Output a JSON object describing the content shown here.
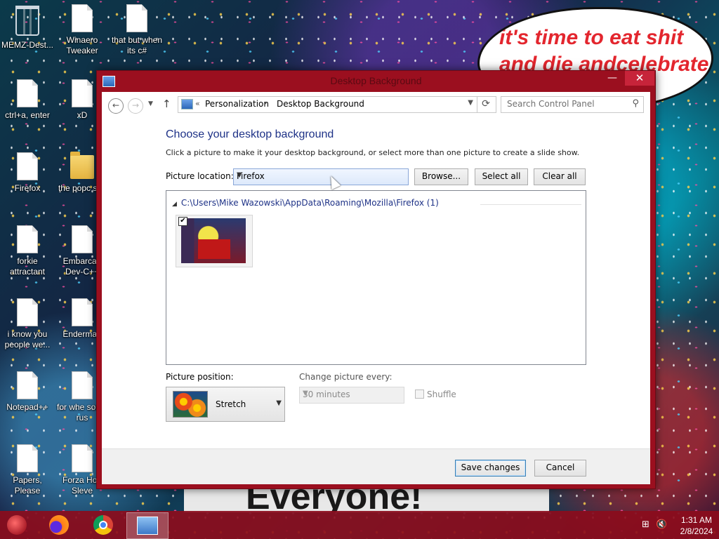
{
  "wallpaper": {
    "bubble_line1": "it's time to eat shit",
    "bubble_line2": "and die andcelebrate",
    "sign_text": "Everyone!"
  },
  "desktop_icons": [
    {
      "label": "MEMZ-Dest...",
      "type": "bin"
    },
    {
      "label": "Winaero Tweaker",
      "type": "doc"
    },
    {
      "label": "that but when its c#",
      "type": "doc"
    },
    {
      "label": "ctrl+a, enter",
      "type": "doc"
    },
    {
      "label": "xD",
      "type": "doc"
    },
    {
      "label": "Firefox",
      "type": "doc"
    },
    {
      "label": "the popc shit",
      "type": "folder"
    },
    {
      "label": "forkie attractant",
      "type": "doc"
    },
    {
      "label": "Embarcad Dev-C++",
      "type": "doc"
    },
    {
      "label": "i know you people we...",
      "type": "doc"
    },
    {
      "label": "Enderman",
      "type": "doc"
    },
    {
      "label": "Notepad++",
      "type": "doc"
    },
    {
      "label": "for whe some rus",
      "type": "doc"
    },
    {
      "label": "Papers, Please",
      "type": "doc"
    },
    {
      "label": "Forza Hori Sleve",
      "type": "doc"
    }
  ],
  "window": {
    "title": "Desktop Background",
    "minimize": "—",
    "maximize": "▢",
    "close": "✕",
    "nav": {
      "back": "←",
      "forward": "→",
      "up": "↑",
      "breadcrumb_prefix": "«",
      "crumb1": "Personalization",
      "separator": "›",
      "crumb2": "Desktop Background",
      "refresh": "⟳",
      "search_placeholder": "Search Control Panel",
      "search_icon": "⚲"
    },
    "heading": "Choose your desktop background",
    "description": "Click a picture to make it your desktop background, or select more than one picture to create a slide show.",
    "picture_location_label": "Picture location:",
    "picture_location_value": "Firefox",
    "browse_button": "Browse...",
    "select_all_button": "Select all",
    "clear_all_button": "Clear all",
    "group_header": "C:\\Users\\Mike Wazowski\\AppData\\Roaming\\Mozilla\\Firefox (1)",
    "thumbnail_checked": "✔",
    "picture_position_label": "Picture position:",
    "picture_position_value": "Stretch",
    "change_picture_label": "Change picture every:",
    "change_picture_value": "30 minutes",
    "shuffle_label": "Shuffle",
    "save_button": "Save changes",
    "cancel_button": "Cancel"
  },
  "taskbar": {
    "time": "1:31 AM",
    "date": "2/8/2024"
  },
  "colors": {
    "window_frame": "#9b0f1f",
    "heading_blue": "#1e3287",
    "taskbar": "#8c0c1c"
  }
}
